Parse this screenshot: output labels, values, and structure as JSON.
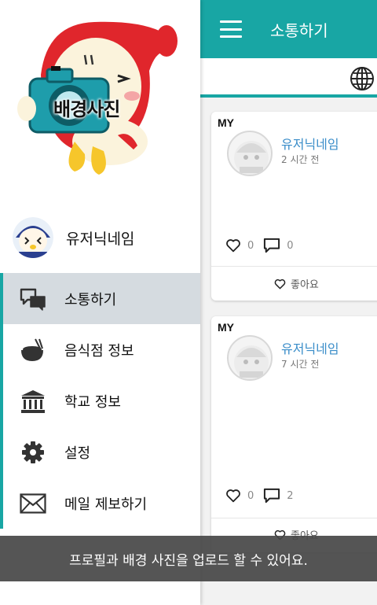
{
  "appbar": {
    "title": "소통하기",
    "menu_icon": "hamburger-icon"
  },
  "search": {
    "globe_icon": "globe-icon"
  },
  "posts": [
    {
      "badge": "MY",
      "nickname": "유저닉네임",
      "time": "2 시간 전",
      "likes": "0",
      "comments": "0",
      "like_label": "좋아요"
    },
    {
      "badge": "MY",
      "nickname": "유저닉네임",
      "time": "7 시간 전",
      "likes": "0",
      "comments": "2",
      "like_label": "좋아요"
    }
  ],
  "drawer": {
    "background_label": "배경사진",
    "profile_name": "유저닉네임",
    "menu": [
      {
        "label": "소통하기",
        "icon": "chat-bubbles-icon",
        "active": true
      },
      {
        "label": "음식점 정보",
        "icon": "rice-bowl-icon",
        "active": false
      },
      {
        "label": "학교 정보",
        "icon": "bank-building-icon",
        "active": false
      },
      {
        "label": "설정",
        "icon": "gear-icon",
        "active": false
      },
      {
        "label": "메일 제보하기",
        "icon": "envelope-icon",
        "active": false
      }
    ]
  },
  "caption": "프로필과 배경 사진을 업로드 할 수 있어요.",
  "colors": {
    "accent": "#18a6a4",
    "link": "#3a8dc9",
    "active_menu_bg": "#d5dbe0"
  }
}
